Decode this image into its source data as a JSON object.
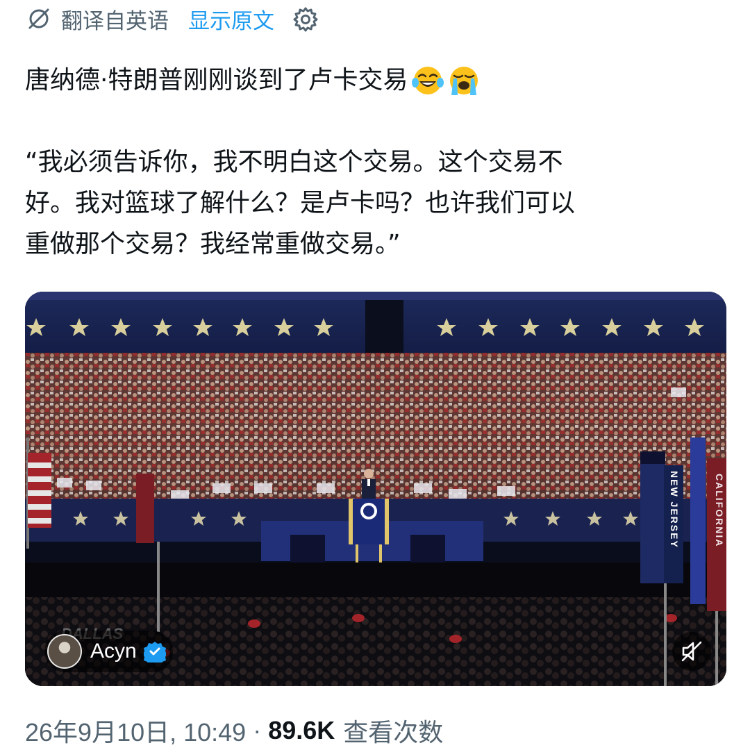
{
  "translation": {
    "translated_from": "翻译自英语",
    "show_original": "显示原文"
  },
  "tweet": {
    "headline": "唐纳德·特朗普刚刚谈到了卢卡交易",
    "emojis": [
      "joy-emoji",
      "loudly-crying-emoji"
    ],
    "quote": "“我必须告诉你，我不明白这个交易。这个交易不\n好。我对篮球了解什么？是卢卡吗？也许我们可以\n重做那个交易？我经常重做交易。”"
  },
  "media": {
    "author_name": "Acyn",
    "verified": true,
    "muted": true,
    "state_signs": [
      "NEW JERSEY",
      "CALIFORNIA"
    ],
    "watermark": "DALLAS"
  },
  "meta": {
    "timestamp": "26年9月10日, 10:49",
    "separator": "·",
    "view_count": "89.6K",
    "views_label": "查看次数"
  },
  "colors": {
    "link_blue": "#1d9bf0",
    "secondary_text": "#536471",
    "primary_text": "#0f1419"
  }
}
